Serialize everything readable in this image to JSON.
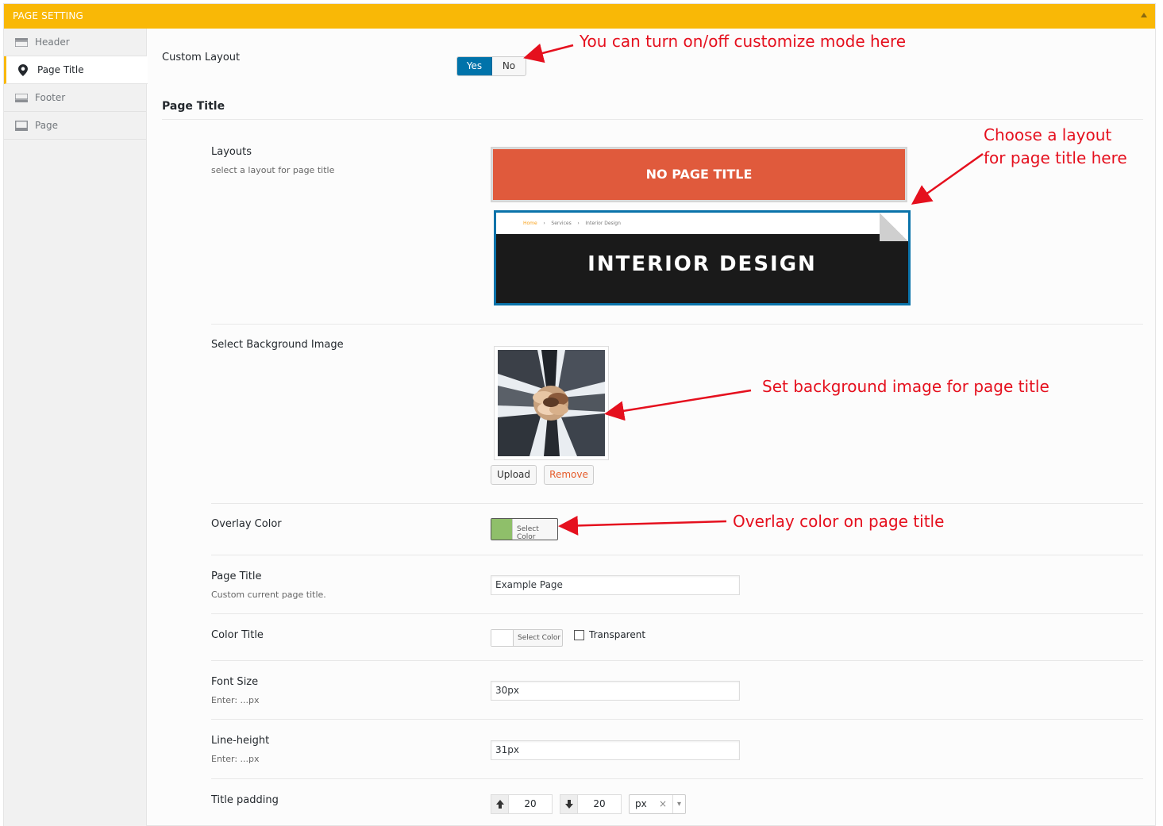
{
  "panel": {
    "title": "PAGE SETTING"
  },
  "sidebar": {
    "items": [
      {
        "label": "Header",
        "icon": "header-icon"
      },
      {
        "label": "Page Title",
        "icon": "map-marker-icon"
      },
      {
        "label": "Footer",
        "icon": "footer-icon"
      },
      {
        "label": "Page",
        "icon": "page-icon"
      }
    ]
  },
  "custom_layout": {
    "label": "Custom Layout",
    "yes": "Yes",
    "no": "No"
  },
  "section": {
    "title": "Page Title"
  },
  "layouts": {
    "label": "Layouts",
    "description": "select a layout for page title",
    "option1_text": "NO PAGE TITLE",
    "option2": {
      "crumb_home": "Home",
      "crumb_sep": "›",
      "crumb_services": "Services",
      "crumb_current": "Interior Design",
      "title": "INTERIOR DESIGN"
    }
  },
  "background_image": {
    "label": "Select Background Image",
    "upload": "Upload",
    "remove": "Remove"
  },
  "overlay_color": {
    "label": "Overlay Color",
    "button": "Select Color",
    "swatch_color": "#8fbf6a"
  },
  "page_title_field": {
    "label": "Page Title",
    "description": "Custom current page title.",
    "value": "Example Page"
  },
  "color_title": {
    "label": "Color Title",
    "button": "Select Color",
    "transparent": "Transparent"
  },
  "font_size": {
    "label": "Font Size",
    "description": "Enter: ...px",
    "value": "30px"
  },
  "line_height": {
    "label": "Line-height",
    "description": "Enter: ...px",
    "value": "31px"
  },
  "title_padding": {
    "label": "Title padding",
    "top": "20",
    "bottom": "20",
    "unit": "px",
    "clear": "×",
    "caret": "▾"
  },
  "annotations": {
    "a1": "You can turn on/off customize mode here",
    "a2_line1": "Choose a layout",
    "a2_line2": "for page title here",
    "a3": "Set background image for page title",
    "a4": "Overlay color on page title"
  },
  "colors": {
    "accent": "#f9b806",
    "primary": "#0073aa",
    "annotation": "#e5101e",
    "layout1_bg": "#e05a3c"
  }
}
